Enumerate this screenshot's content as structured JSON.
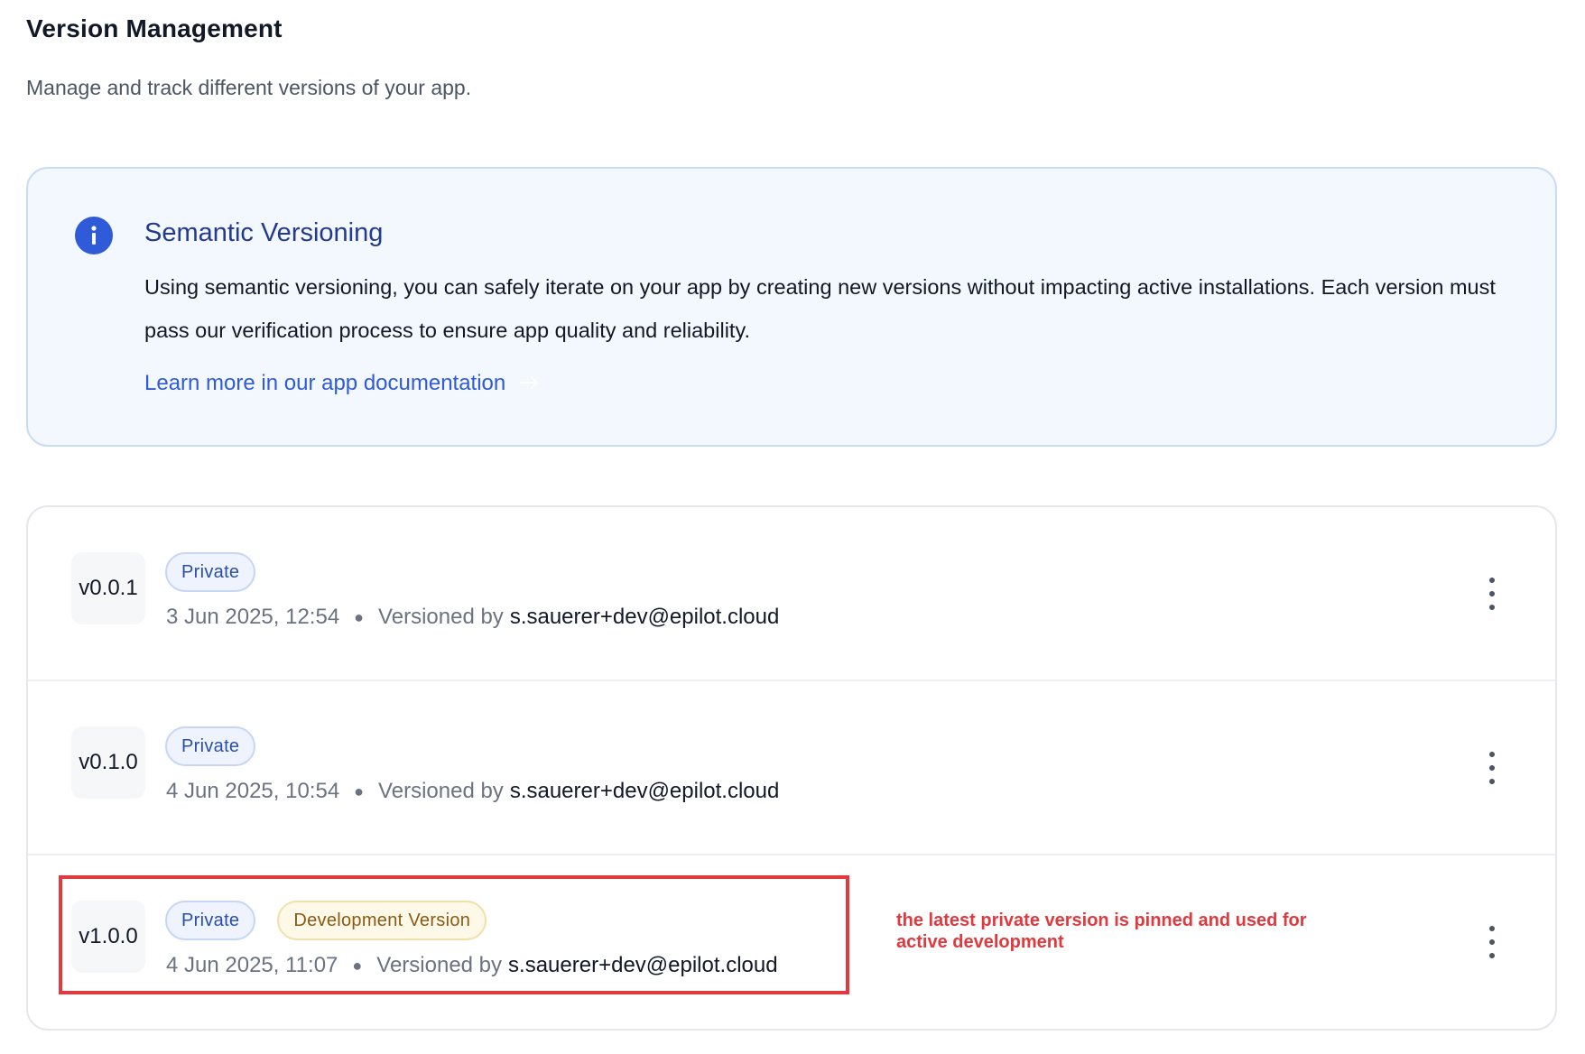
{
  "header": {
    "title": "Version Management",
    "subtitle": "Manage and track different versions of your app."
  },
  "info_callout": {
    "icon": "info-icon",
    "title": "Semantic Versioning",
    "body": "Using semantic versioning, you can safely iterate on your app by creating new versions without impacting active installations. Each version must pass our verification process to ensure app quality and reliability.",
    "link_label": "Learn more in our app documentation",
    "link_icon": "arrow-right-icon"
  },
  "versions": [
    {
      "version": "v0.0.1",
      "badges": [
        "Private"
      ],
      "date": "3 Jun 2025, 12:54",
      "versioned_by_label": "Versioned by",
      "user": "s.sauerer+dev@epilot.cloud"
    },
    {
      "version": "v0.1.0",
      "badges": [
        "Private"
      ],
      "date": "4 Jun 2025, 10:54",
      "versioned_by_label": "Versioned by",
      "user": "s.sauerer+dev@epilot.cloud"
    },
    {
      "version": "v1.0.0",
      "badges": [
        "Private",
        "Development Version"
      ],
      "date": "4 Jun 2025, 11:07",
      "versioned_by_label": "Versioned by",
      "user": "s.sauerer+dev@epilot.cloud"
    }
  ],
  "annotation": {
    "text": "the latest private version is pinned and used for active development",
    "color": "#e0393e"
  },
  "colors": {
    "accent_blue": "#2f5bd8",
    "callout_bg": "#f3f7fe",
    "private_badge": "#eef3fd",
    "dev_badge": "#fdf8e7"
  }
}
